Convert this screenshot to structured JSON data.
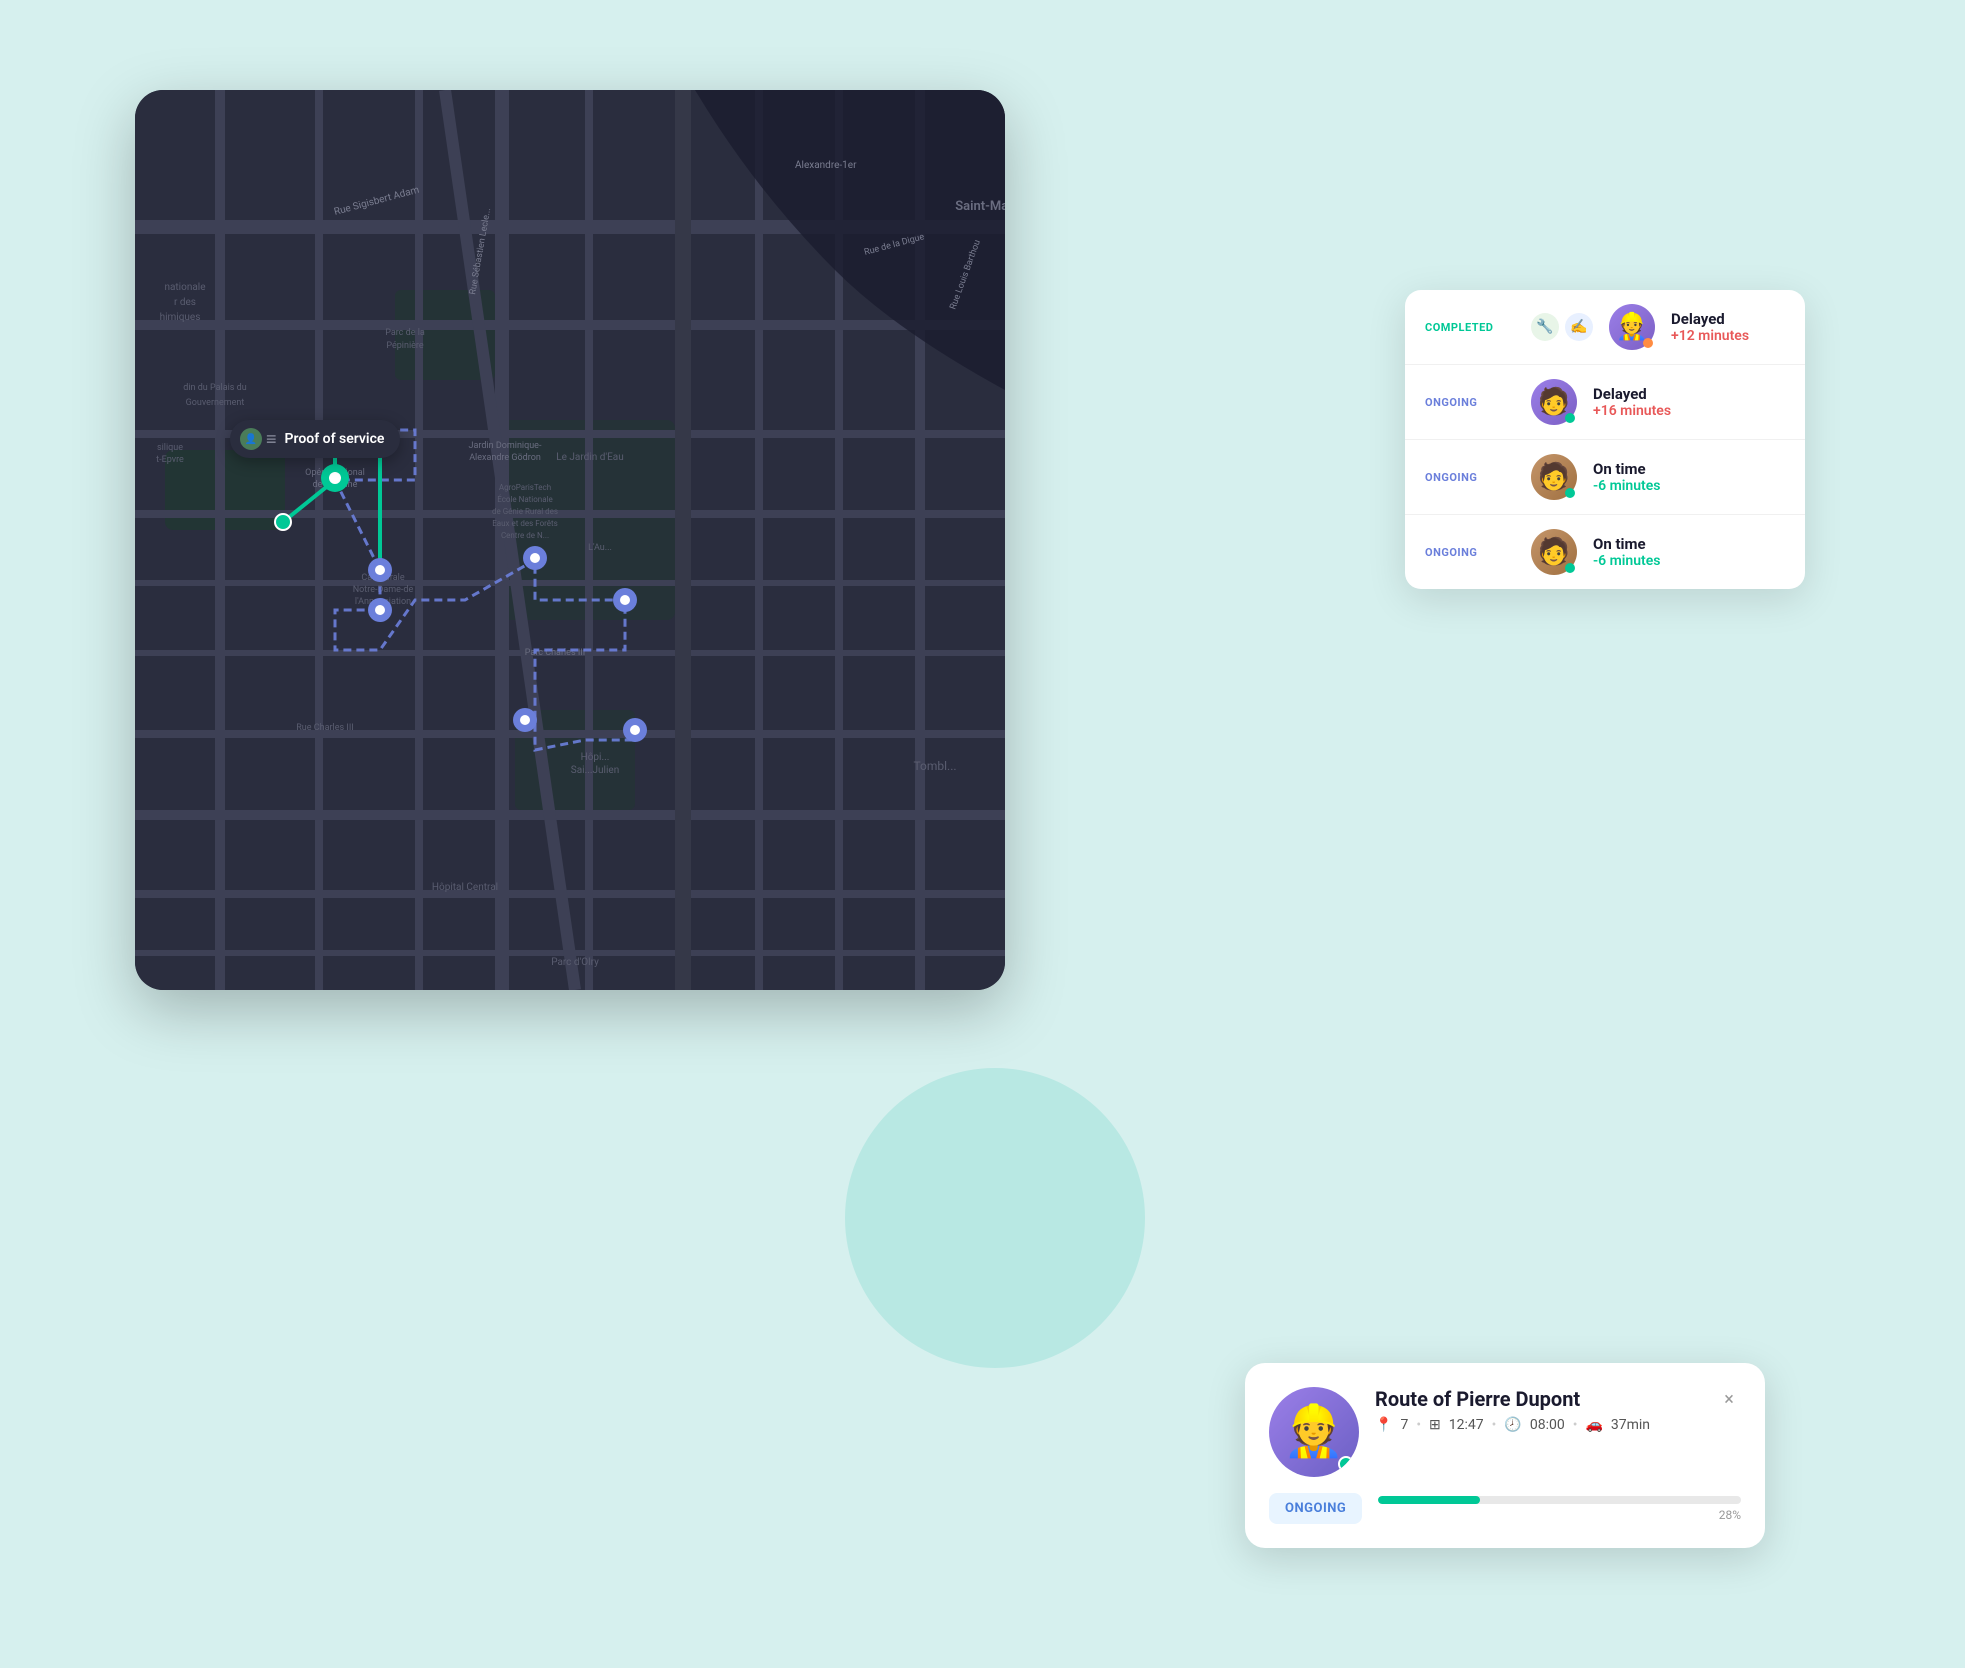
{
  "background": {
    "color": "#d6f0ee"
  },
  "proof_badge": {
    "label": "Proof of service"
  },
  "status_panel": {
    "rows": [
      {
        "status": "COMPLETED",
        "status_type": "completed",
        "avatar_type": "orange",
        "timing_label": "Delayed",
        "timing_value": "+12 minutes",
        "timing_type": "delayed"
      },
      {
        "status": "ONGOING",
        "status_type": "ongoing",
        "avatar_type": "purple",
        "timing_label": "Delayed",
        "timing_value": "+16 minutes",
        "timing_type": "delayed"
      },
      {
        "status": "ONGOING",
        "status_type": "ongoing",
        "avatar_type": "brown",
        "timing_label": "On time",
        "timing_value": "-6 minutes",
        "timing_type": "ontime"
      },
      {
        "status": "ONGOING",
        "status_type": "ongoing",
        "avatar_type": "brown2",
        "timing_label": "On time",
        "timing_value": "-6 minutes",
        "timing_type": "ontime"
      }
    ]
  },
  "route_card": {
    "title": "Route of Pierre Dupont",
    "stops": "7",
    "time1": "12:47",
    "time2": "08:00",
    "drive": "37min",
    "status": "ONGOING",
    "progress_pct": 28,
    "progress_label": "28%",
    "close_label": "×"
  }
}
